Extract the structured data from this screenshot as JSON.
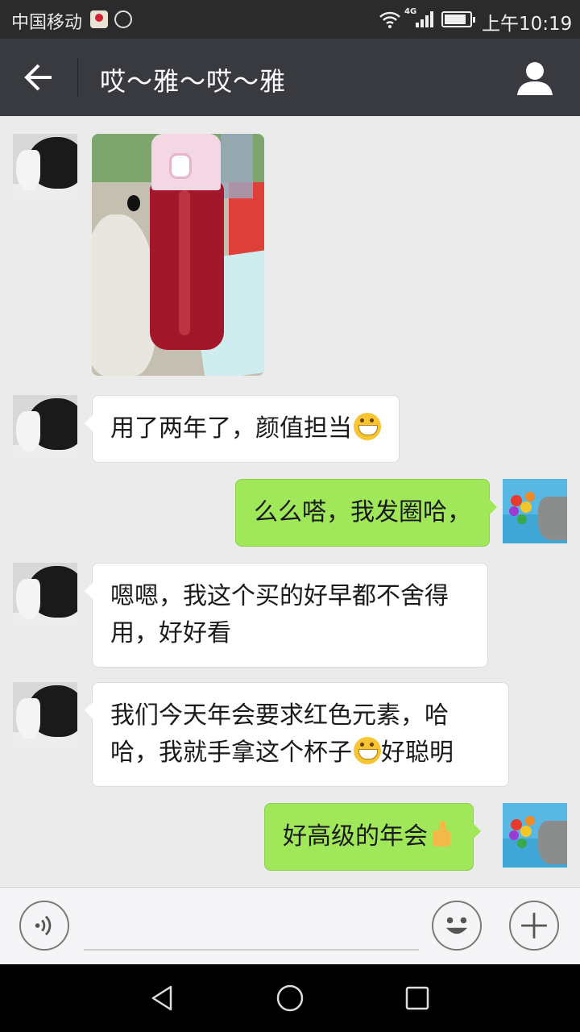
{
  "status_bar": {
    "carrier": "中国移动",
    "network": "4G",
    "time": "上午10:19"
  },
  "header": {
    "title": "哎～雅～哎～雅",
    "back_icon": "arrow-left-icon",
    "profile_icon": "person-icon"
  },
  "messages": [
    {
      "side": "in",
      "type": "image"
    },
    {
      "side": "in",
      "type": "text",
      "text": "用了两年了，颜值担当",
      "emoji_after": "grin-emoji"
    },
    {
      "side": "out",
      "type": "text",
      "text": "么么嗒，我发圈哈，"
    },
    {
      "side": "in",
      "type": "text",
      "lines": [
        "嗯嗯，我这个买的好早都不舍得",
        "用，好好看"
      ]
    },
    {
      "side": "in",
      "type": "text",
      "lines": [
        "我们今天年会要求红色元素，哈",
        "哈，我就手拿这个杯子",
        "好聪明"
      ],
      "emoji_mid": "grin-emoji"
    },
    {
      "side": "out",
      "type": "text",
      "text": "好高级的年会",
      "emoji_after": "thumbs-up-emoji"
    }
  ],
  "input_bar": {
    "placeholder": "",
    "voice_icon": "voice-icon",
    "emoji_icon": "smiley-icon",
    "plus_icon": "plus-icon"
  },
  "colors": {
    "title_bar": "#393a3f",
    "chat_bg": "#ebebeb",
    "outgoing_bubble": "#a0e75a",
    "incoming_bubble": "#ffffff"
  }
}
